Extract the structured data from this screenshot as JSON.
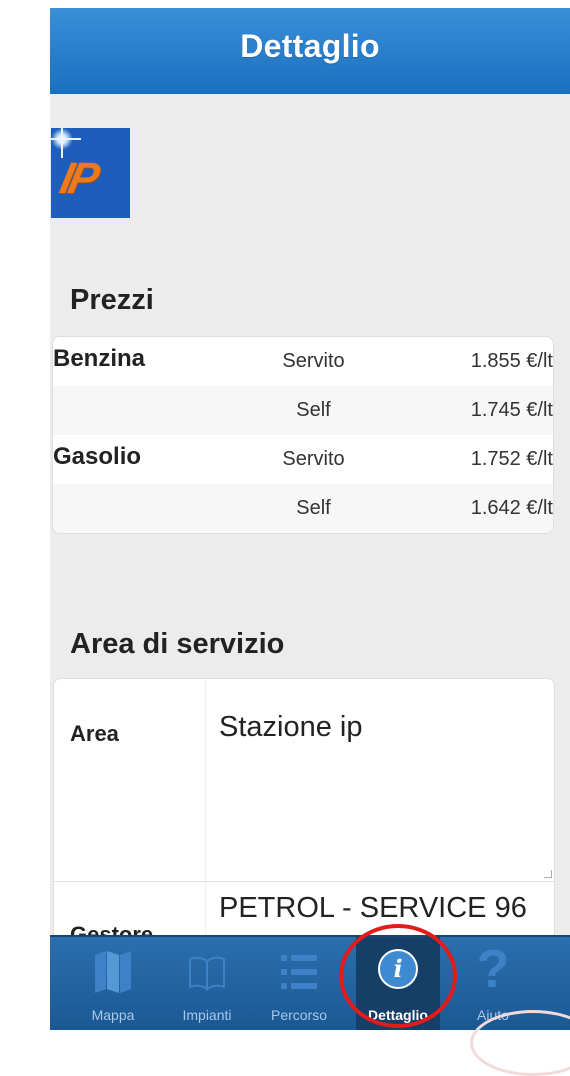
{
  "header": {
    "title": "Dettaglio"
  },
  "logo": {
    "brand": "IP"
  },
  "prices_section": {
    "title": "Prezzi",
    "rows": [
      {
        "fuel": "Benzina",
        "mode": "Servito",
        "price": "1.855 €/lt"
      },
      {
        "fuel": "",
        "mode": "Self",
        "price": "1.745 €/lt"
      },
      {
        "fuel": "Gasolio",
        "mode": "Servito",
        "price": "1.752 €/lt"
      },
      {
        "fuel": "",
        "mode": "Self",
        "price": "1.642 €/lt"
      }
    ]
  },
  "service_area": {
    "title": "Area di servizio",
    "area_label": "Area",
    "area_value": "Stazione ip",
    "gestore_label": "Gestore",
    "gestore_value": "PETROL - SERVICE 96"
  },
  "tabs": [
    {
      "label": "Mappa",
      "icon": "map-icon"
    },
    {
      "label": "Impianti",
      "icon": "book-icon"
    },
    {
      "label": "Percorso",
      "icon": "list-icon"
    },
    {
      "label": "Dettaglio",
      "icon": "info-icon",
      "active": true
    },
    {
      "label": "Aiuto",
      "icon": "help-icon"
    }
  ],
  "colors": {
    "header": "#1a6fc0",
    "tabbar": "#1f5f9c",
    "annotation": "#e21b1b",
    "logo_bg": "#1d5dbd",
    "logo_mark": "#f07a1a"
  }
}
